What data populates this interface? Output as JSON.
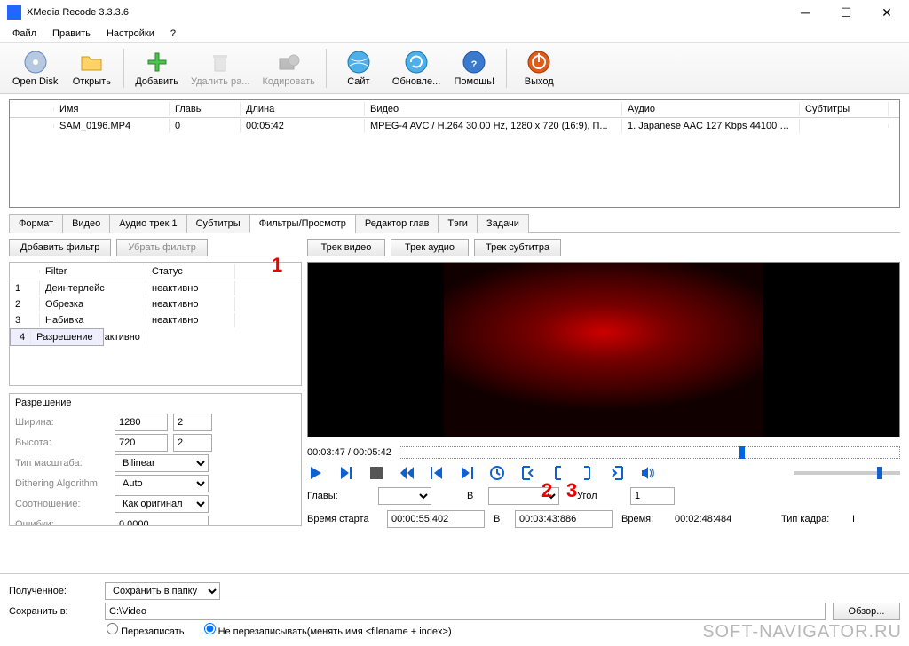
{
  "window": {
    "title": "XMedia Recode 3.3.3.6"
  },
  "menu": {
    "file": "Файл",
    "edit": "Править",
    "settings": "Настройки",
    "help": "?"
  },
  "toolbar": {
    "open_disk": "Open Disk",
    "open": "Открыть",
    "add": "Добавить",
    "del": "Удалить ра...",
    "encode": "Кодировать",
    "site": "Сайт",
    "update": "Обновле...",
    "help": "Помощь!",
    "exit": "Выход"
  },
  "grid": {
    "head": {
      "name": "Имя",
      "chap": "Главы",
      "len": "Длина",
      "vid": "Видео",
      "aud": "Аудио",
      "sub": "Субтитры"
    },
    "row": {
      "name": "SAM_0196.MP4",
      "chap": "0",
      "len": "00:05:42",
      "vid": "MPEG-4 AVC / H.264 30.00 Hz, 1280 x 720 (16:9), П...",
      "aud": "1. Japanese AAC  127 Kbps 44100 H..."
    }
  },
  "tabs": [
    "Формат",
    "Видео",
    "Аудио трек 1",
    "Субтитры",
    "Фильтры/Просмотр",
    "Редактор глав",
    "Тэги",
    "Задачи"
  ],
  "filters": {
    "add": "Добавить фильтр",
    "remove": "Убрать фильтр",
    "vtrack": "Трек видео",
    "atrack": "Трек аудио",
    "strack": "Трек субтитра",
    "head": {
      "num": "",
      "filter": "Filter",
      "status": "Статус"
    },
    "rows": [
      {
        "n": "1",
        "name": "Деинтерлейс",
        "status": "неактивно"
      },
      {
        "n": "2",
        "name": "Обрезка",
        "status": "неактивно"
      },
      {
        "n": "3",
        "name": "Набивка",
        "status": "неактивно"
      },
      {
        "n": "4",
        "name": "Разрешение",
        "status": "активно"
      }
    ]
  },
  "resolution": {
    "title": "Разрешение",
    "width_l": "Ширина:",
    "width": "1280",
    "w2": "2",
    "height_l": "Высота:",
    "height": "720",
    "h2": "2",
    "scale_l": "Тип масштаба:",
    "scale": "Bilinear",
    "dith_l": "Dithering Algorithm",
    "dith": "Auto",
    "aspect_l": "Соотношение:",
    "aspect": "Как оригинал",
    "err_l": "Ошибки:",
    "err": "0.0000"
  },
  "player": {
    "time": "00:03:47 / 00:05:42",
    "chapters_l": "Главы:",
    "b": "B",
    "angle_l": "Угол",
    "angle": "1",
    "start_l": "Время старта",
    "start": "00:00:55:402",
    "end": "00:03:43:886",
    "dur_l": "Время:",
    "dur": "00:02:48:484",
    "ftype_l": "Тип кадра:",
    "ftype": "I"
  },
  "bottom": {
    "got_l": "Полученное:",
    "got": "Сохранить в папку",
    "save_l": "Сохранить в:",
    "path": "C:\\Video",
    "browse": "Обзор...",
    "overwrite": "Перезаписать",
    "no_overwrite": "Не перезаписывать(менять имя <filename + index>)"
  },
  "watermark": "SOFT-NAVIGATOR.RU",
  "ann": {
    "a1": "1",
    "a2": "2",
    "a3": "3"
  }
}
